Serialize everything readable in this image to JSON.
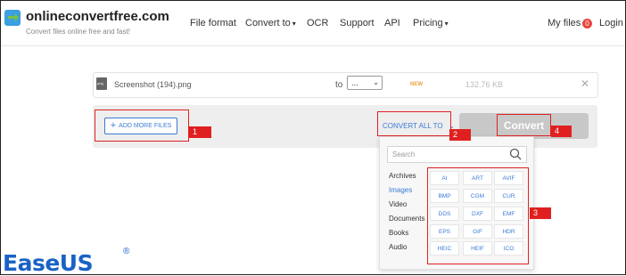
{
  "header": {
    "brand": "onlineconvertfree.com",
    "tagline": "Convert files online free and fast!",
    "nav": {
      "file_format": "File format",
      "convert_to": "Convert to",
      "ocr": "OCR",
      "support": "Support",
      "api": "API",
      "pricing": "Pricing",
      "my_files": "My files",
      "my_files_count": "0",
      "login": "Login"
    }
  },
  "file": {
    "name": "Screenshot (194).png",
    "icon_text": "png",
    "to_label": "to",
    "format_select": "...",
    "status_tag": "NEW",
    "size": "132.76 KB"
  },
  "actions": {
    "add_more": "ADD MORE FILES",
    "convert_all_to": "CONVERT ALL TO",
    "convert": "Convert"
  },
  "annotations": [
    "1",
    "2",
    "3",
    "4"
  ],
  "dropdown": {
    "search_placeholder": "Search",
    "categories": [
      "Archives",
      "Images",
      "Video",
      "Documents",
      "Books",
      "Audio"
    ],
    "active_category": "Images",
    "formats": [
      "AI",
      "ART",
      "AVIF",
      "BMP",
      "CGM",
      "CUR",
      "DDS",
      "DXF",
      "EMF",
      "EPS",
      "GIF",
      "HDR",
      "HEIC",
      "HEIF",
      "ICO"
    ]
  },
  "watermark": {
    "text": "EaseUS",
    "reg": "®"
  },
  "colors": {
    "accent": "#3a7bd5",
    "annotation_red": "#e02020",
    "convert_disabled": "#c8c8c8",
    "watermark_blue": "#1a62c4"
  }
}
